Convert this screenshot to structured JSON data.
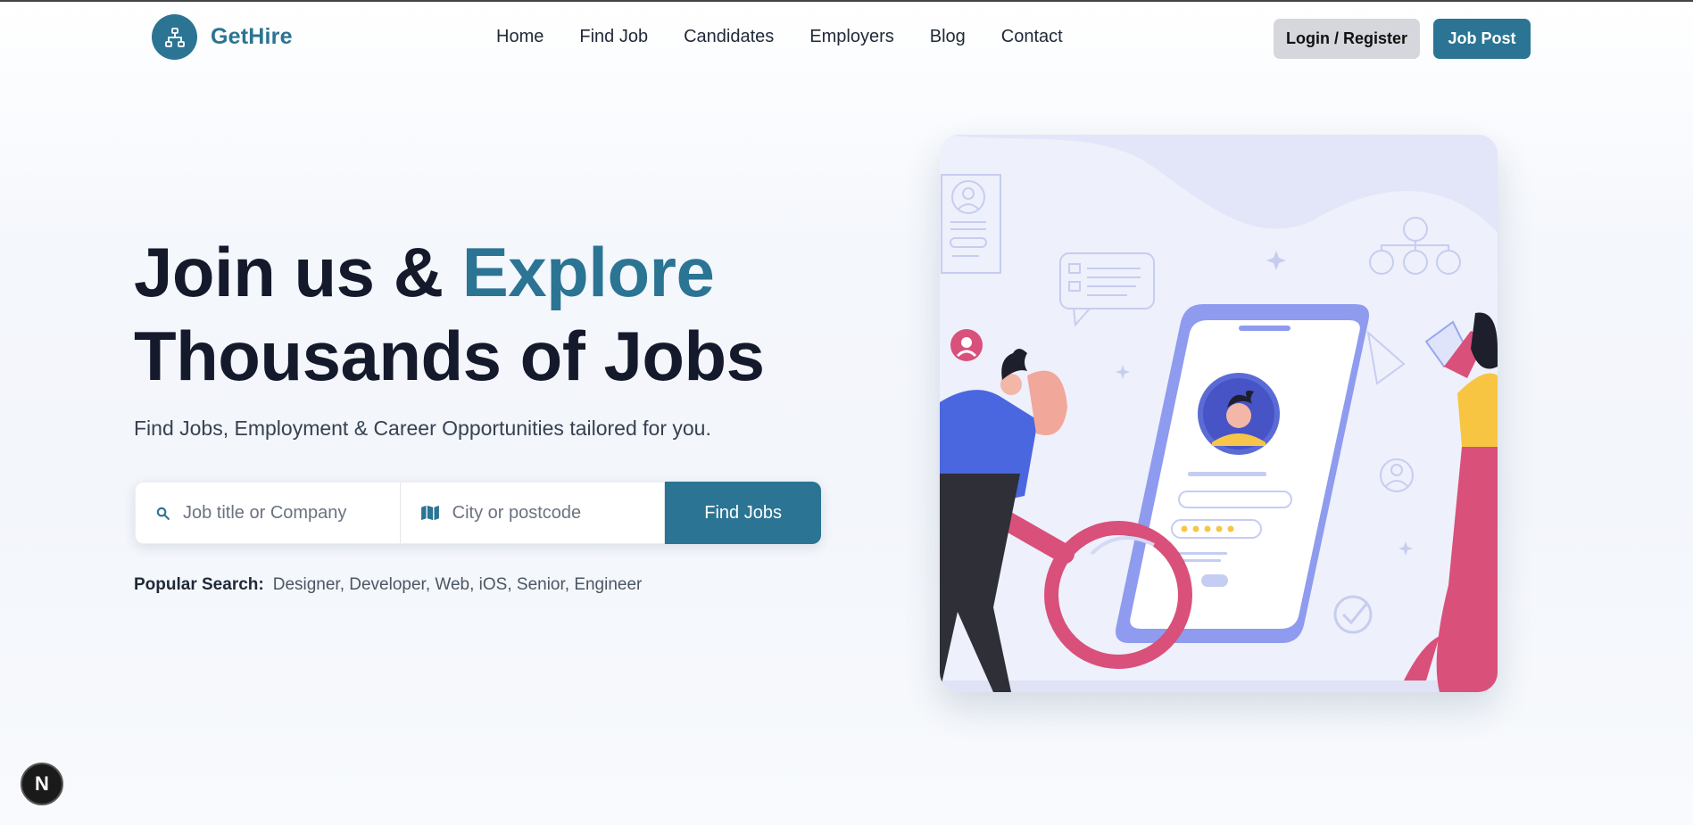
{
  "brand": {
    "name": "GetHire",
    "icon": "sitemap-icon",
    "color": "#2b7493"
  },
  "nav": {
    "links": [
      "Home",
      "Find Job",
      "Candidates",
      "Employers",
      "Blog",
      "Contact"
    ],
    "login_label": "Login / Register",
    "post_label": "Job Post"
  },
  "hero": {
    "title_part1": "Join us & ",
    "title_accent": "Explore",
    "title_line2": "Thousands of Jobs",
    "subtitle": "Find Jobs, Employment & Career Opportunities tailored for you."
  },
  "search": {
    "job_placeholder": "Job title or Company",
    "location_placeholder": "City or postcode",
    "job_icon": "search-icon",
    "location_icon": "map-icon",
    "button_label": "Find Jobs"
  },
  "popular": {
    "label": "Popular Search:",
    "tags": "Designer, Developer, Web, iOS, Senior, Engineer"
  },
  "badge": {
    "label": "N"
  },
  "colors": {
    "accent": "#2b7493",
    "title": "#141a2b",
    "login_bg": "#d5d7dc"
  }
}
